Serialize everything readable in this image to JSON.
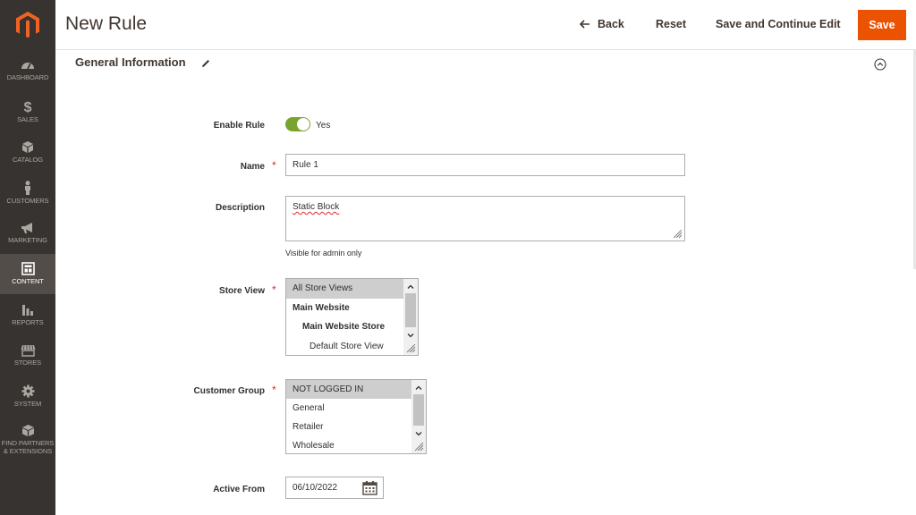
{
  "sidebar": {
    "items": [
      {
        "label": "DASHBOARD",
        "icon": "dashboard-icon"
      },
      {
        "label": "SALES",
        "icon": "dollar-icon"
      },
      {
        "label": "CATALOG",
        "icon": "cube-icon"
      },
      {
        "label": "CUSTOMERS",
        "icon": "person-icon"
      },
      {
        "label": "MARKETING",
        "icon": "megaphone-icon"
      },
      {
        "label": "CONTENT",
        "icon": "layout-icon",
        "active": true
      },
      {
        "label": "REPORTS",
        "icon": "bar-chart-icon"
      },
      {
        "label": "STORES",
        "icon": "storefront-icon"
      },
      {
        "label": "SYSTEM",
        "icon": "gear-icon"
      },
      {
        "label_line1": "FIND PARTNERS",
        "label_line2": "& EXTENSIONS",
        "icon": "box-icon"
      }
    ]
  },
  "header": {
    "title": "New Rule",
    "back_label": "Back",
    "reset_label": "Reset",
    "save_continue_label": "Save and Continue Edit",
    "save_label": "Save"
  },
  "section": {
    "title": "General Information"
  },
  "form": {
    "enable_rule": {
      "label": "Enable Rule",
      "value_label": "Yes",
      "enabled": true
    },
    "name": {
      "label": "Name",
      "value": "Rule 1"
    },
    "description": {
      "label": "Description",
      "value": "Static Block",
      "note": "Visible for admin only"
    },
    "store_view": {
      "label": "Store View",
      "options": [
        "All Store Views",
        "Main Website",
        "Main Website Store",
        "Default Store View"
      ],
      "selected": "All Store Views"
    },
    "customer_group": {
      "label": "Customer Group",
      "options": [
        "NOT LOGGED IN",
        "General",
        "Retailer",
        "Wholesale"
      ],
      "selected": "NOT LOGGED IN"
    },
    "active_from": {
      "label": "Active From",
      "value": "06/10/2022"
    }
  },
  "colors": {
    "sidebar_bg": "#373330",
    "sidebar_active": "#524d49",
    "accent": "#eb5202",
    "toggle_on": "#79a22e"
  }
}
